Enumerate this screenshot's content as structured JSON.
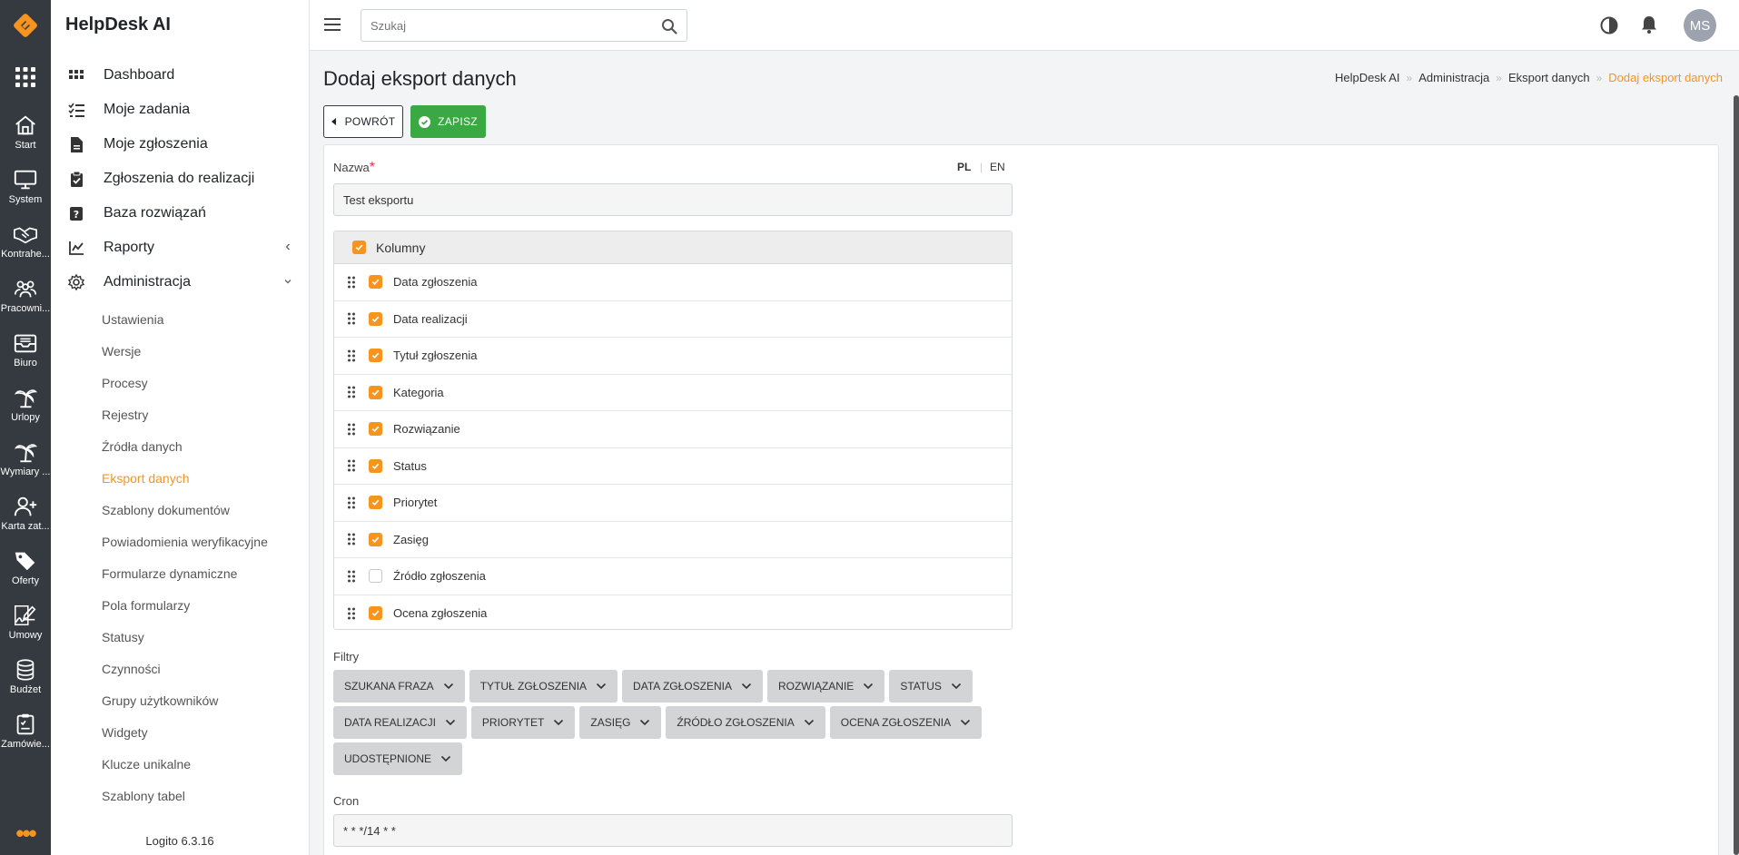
{
  "app": {
    "name": "HelpDesk AI",
    "version": "Logito 6.3.16"
  },
  "rail": {
    "items": [
      {
        "label": "Start",
        "icon": "home-icon"
      },
      {
        "label": "System",
        "icon": "monitor-icon"
      },
      {
        "label": "Kontrahe...",
        "icon": "handshake-icon"
      },
      {
        "label": "Pracowni...",
        "icon": "users-icon"
      },
      {
        "label": "Biuro",
        "icon": "inbox-icon"
      },
      {
        "label": "Urlopy",
        "icon": "palm-tree-icon"
      },
      {
        "label": "Wymiary ...",
        "icon": "palm-tree-icon"
      },
      {
        "label": "Karta zat...",
        "icon": "user-plus-icon"
      },
      {
        "label": "Oferty",
        "icon": "tags-icon"
      },
      {
        "label": "Umowy",
        "icon": "signature-icon"
      },
      {
        "label": "Budżet",
        "icon": "coins-icon"
      },
      {
        "label": "Zamówie...",
        "icon": "clipboard-icon"
      }
    ],
    "more": "•••"
  },
  "sidebar": {
    "main": [
      {
        "label": "Dashboard",
        "icon": "grid-icon"
      },
      {
        "label": "Moje zadania",
        "icon": "tasks-icon"
      },
      {
        "label": "Moje zgłoszenia",
        "icon": "file-icon"
      },
      {
        "label": "Zgłoszenia do realizacji",
        "icon": "clipboard-icon"
      },
      {
        "label": "Baza rozwiązań",
        "icon": "question-icon"
      },
      {
        "label": "Raporty",
        "icon": "chart-icon"
      },
      {
        "label": "Administracja",
        "icon": "gear-icon"
      }
    ],
    "sub": [
      "Ustawienia",
      "Wersje",
      "Procesy",
      "Rejestry",
      "Źródła danych",
      "Eksport danych",
      "Szablony dokumentów",
      "Powiadomienia weryfikacyjne",
      "Formularze dynamiczne",
      "Pola formularzy",
      "Statusy",
      "Czynności",
      "Grupy użytkowników",
      "Widgety",
      "Klucze unikalne",
      "Szablony tabel"
    ],
    "active_sub": "Eksport danych"
  },
  "topbar": {
    "search_placeholder": "Szukaj",
    "avatar": "MS"
  },
  "page": {
    "title": "Dodaj eksport danych",
    "breadcrumb": [
      "HelpDesk AI",
      "Administracja",
      "Eksport danych",
      "Dodaj eksport danych"
    ],
    "back_label": "POWRÓT",
    "save_label": "ZAPISZ"
  },
  "form": {
    "name_label": "Nazwa",
    "lang_pl": "PL",
    "lang_en": "EN",
    "name_value": "Test eksportu",
    "columns_header": "Kolumny",
    "columns": [
      {
        "label": "Data zgłoszenia",
        "checked": true
      },
      {
        "label": "Data realizacji",
        "checked": true
      },
      {
        "label": "Tytuł zgłoszenia",
        "checked": true
      },
      {
        "label": "Kategoria",
        "checked": true
      },
      {
        "label": "Rozwiązanie",
        "checked": true
      },
      {
        "label": "Status",
        "checked": true
      },
      {
        "label": "Priorytet",
        "checked": true
      },
      {
        "label": "Zasięg",
        "checked": true
      },
      {
        "label": "Źródło zgłoszenia",
        "checked": false
      },
      {
        "label": "Ocena zgłoszenia",
        "checked": true
      }
    ],
    "filters_label": "Filtry",
    "filters": [
      [
        "SZUKANA FRAZA",
        "TYTUŁ ZGŁOSZENIA",
        "DATA ZGŁOSZENIA",
        "ROZWIĄZANIE",
        "STATUS"
      ],
      [
        "DATA REALIZACJI",
        "PRIORYTET",
        "ZASIĘG",
        "ŹRÓDŁO ZGŁOSZENIA",
        "OCENA ZGŁOSZENIA"
      ],
      [
        "UDOSTĘPNIONE"
      ]
    ],
    "cron_label": "Cron",
    "cron_value": "* * */14 * *"
  },
  "colors": {
    "accent": "#f7941d",
    "success": "#3aa843",
    "rail": "#343a40"
  }
}
